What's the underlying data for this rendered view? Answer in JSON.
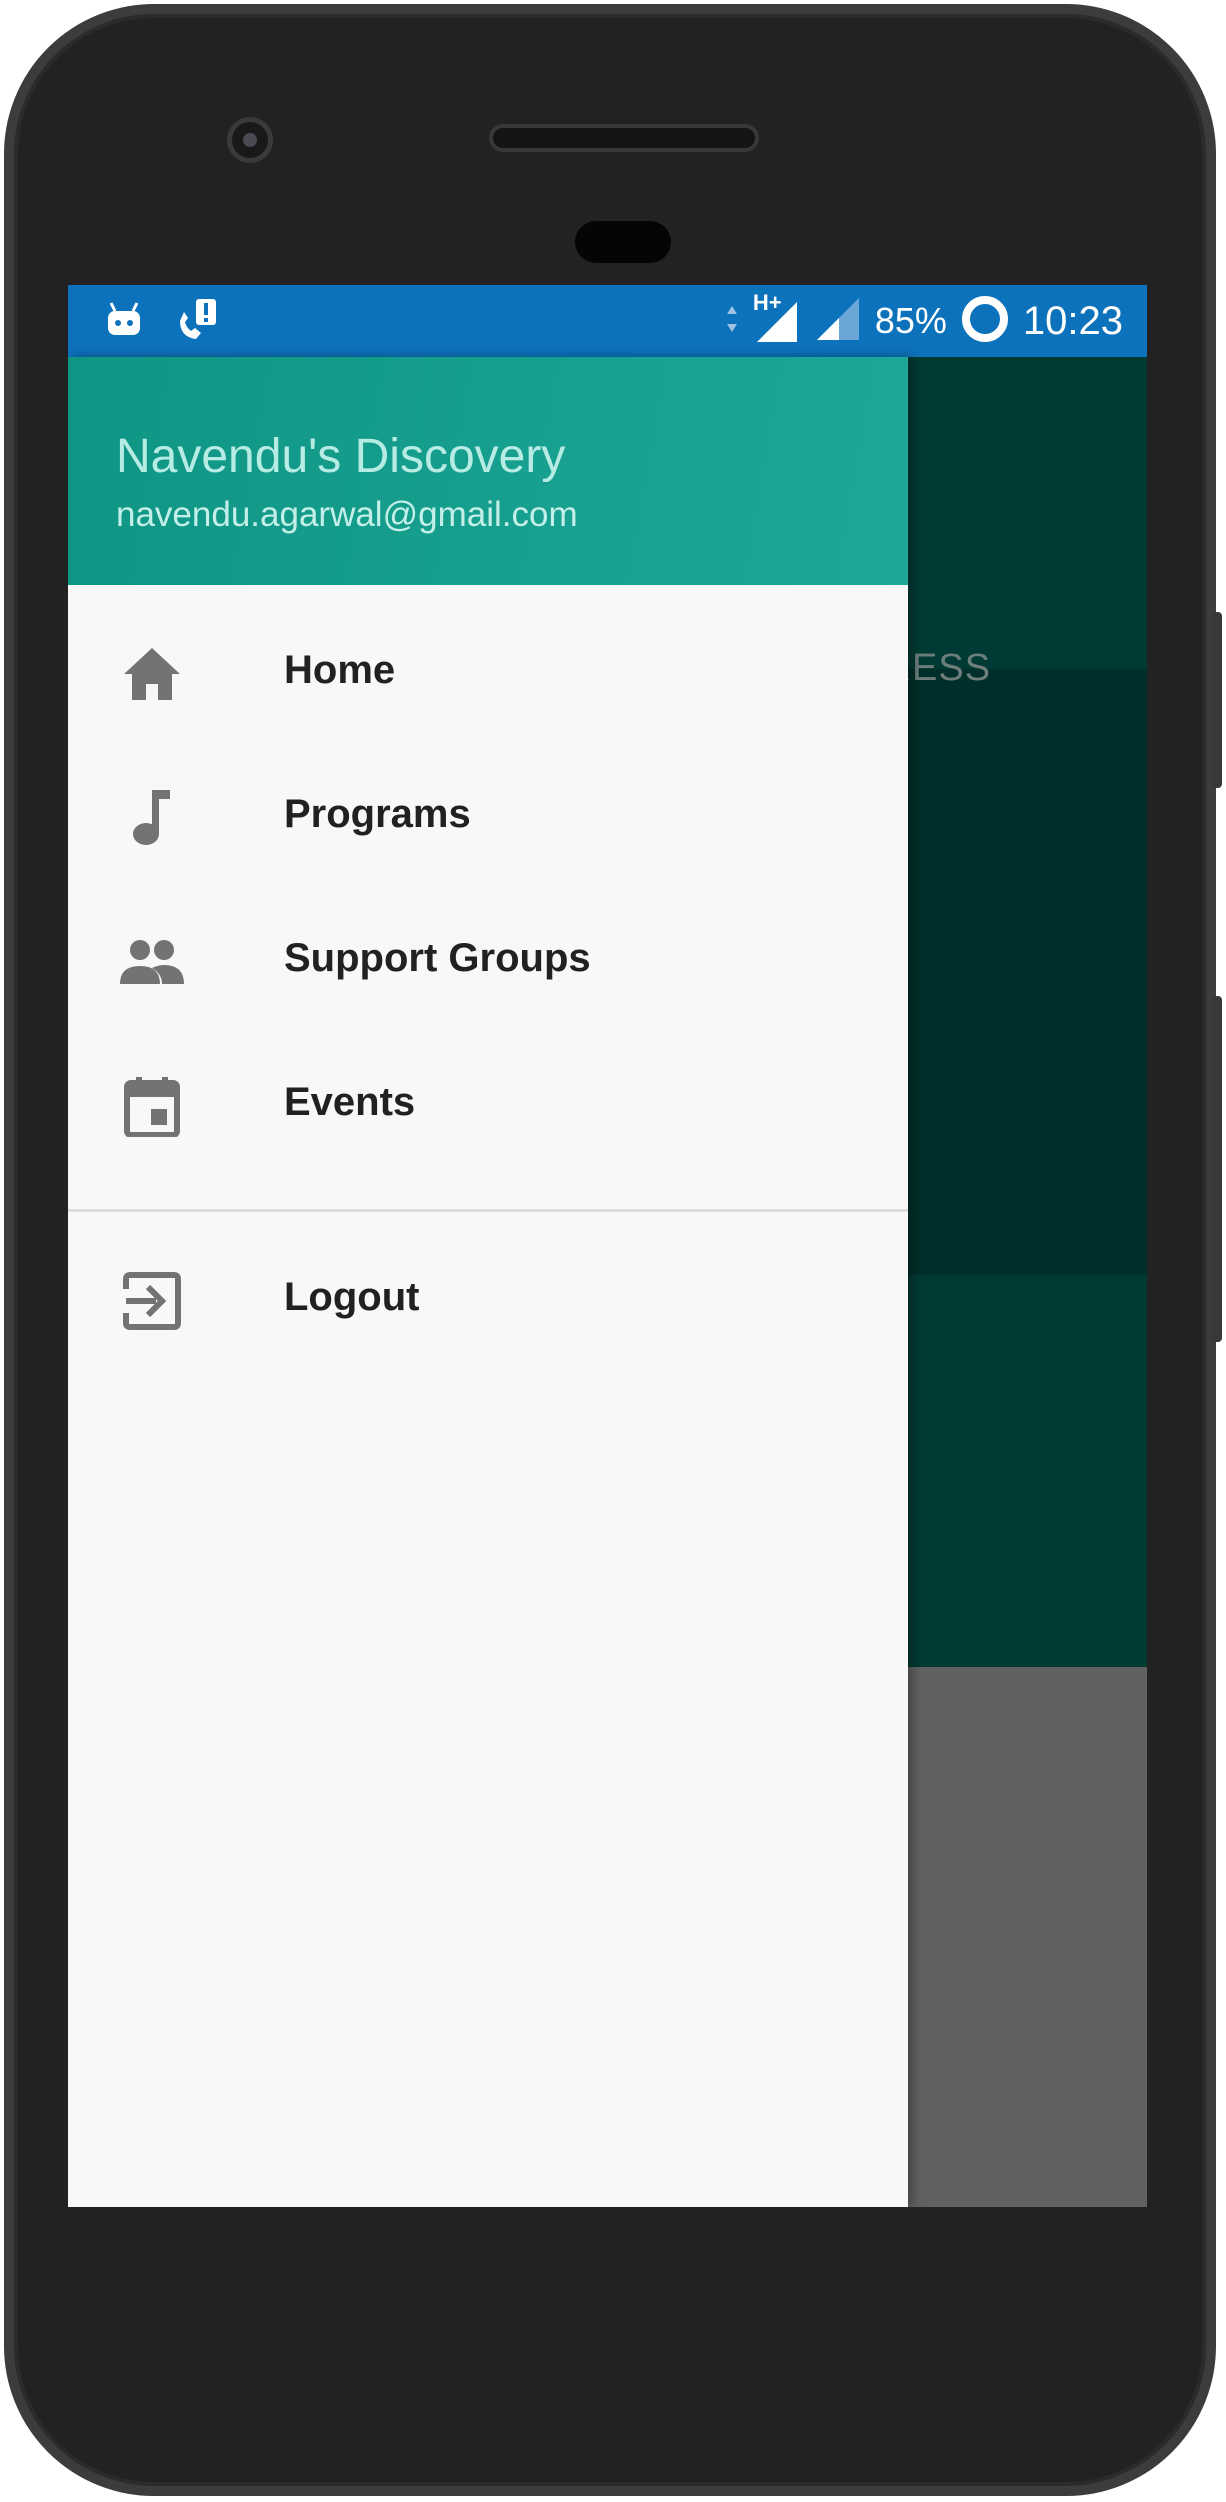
{
  "status_bar": {
    "network": "H+",
    "battery": "85%",
    "time": "10:23"
  },
  "background": {
    "tab_partial": "GRESS"
  },
  "drawer": {
    "header": {
      "name": "Navendu's Discovery",
      "email": "navendu.agarwal@gmail.com"
    },
    "items": [
      {
        "label": "Home",
        "icon": "home-icon"
      },
      {
        "label": "Programs",
        "icon": "music-note-icon"
      },
      {
        "label": "Support Groups",
        "icon": "group-icon"
      },
      {
        "label": "Events",
        "icon": "calendar-icon"
      }
    ],
    "secondary_items": [
      {
        "label": "Logout",
        "icon": "logout-icon"
      }
    ]
  },
  "colors": {
    "status_bar": "#0c72bb",
    "header_accent": "#0f9584",
    "drawer_background": "#f8f8f8",
    "icon": "#737373",
    "scrim_dark_teal": "#003a34"
  }
}
